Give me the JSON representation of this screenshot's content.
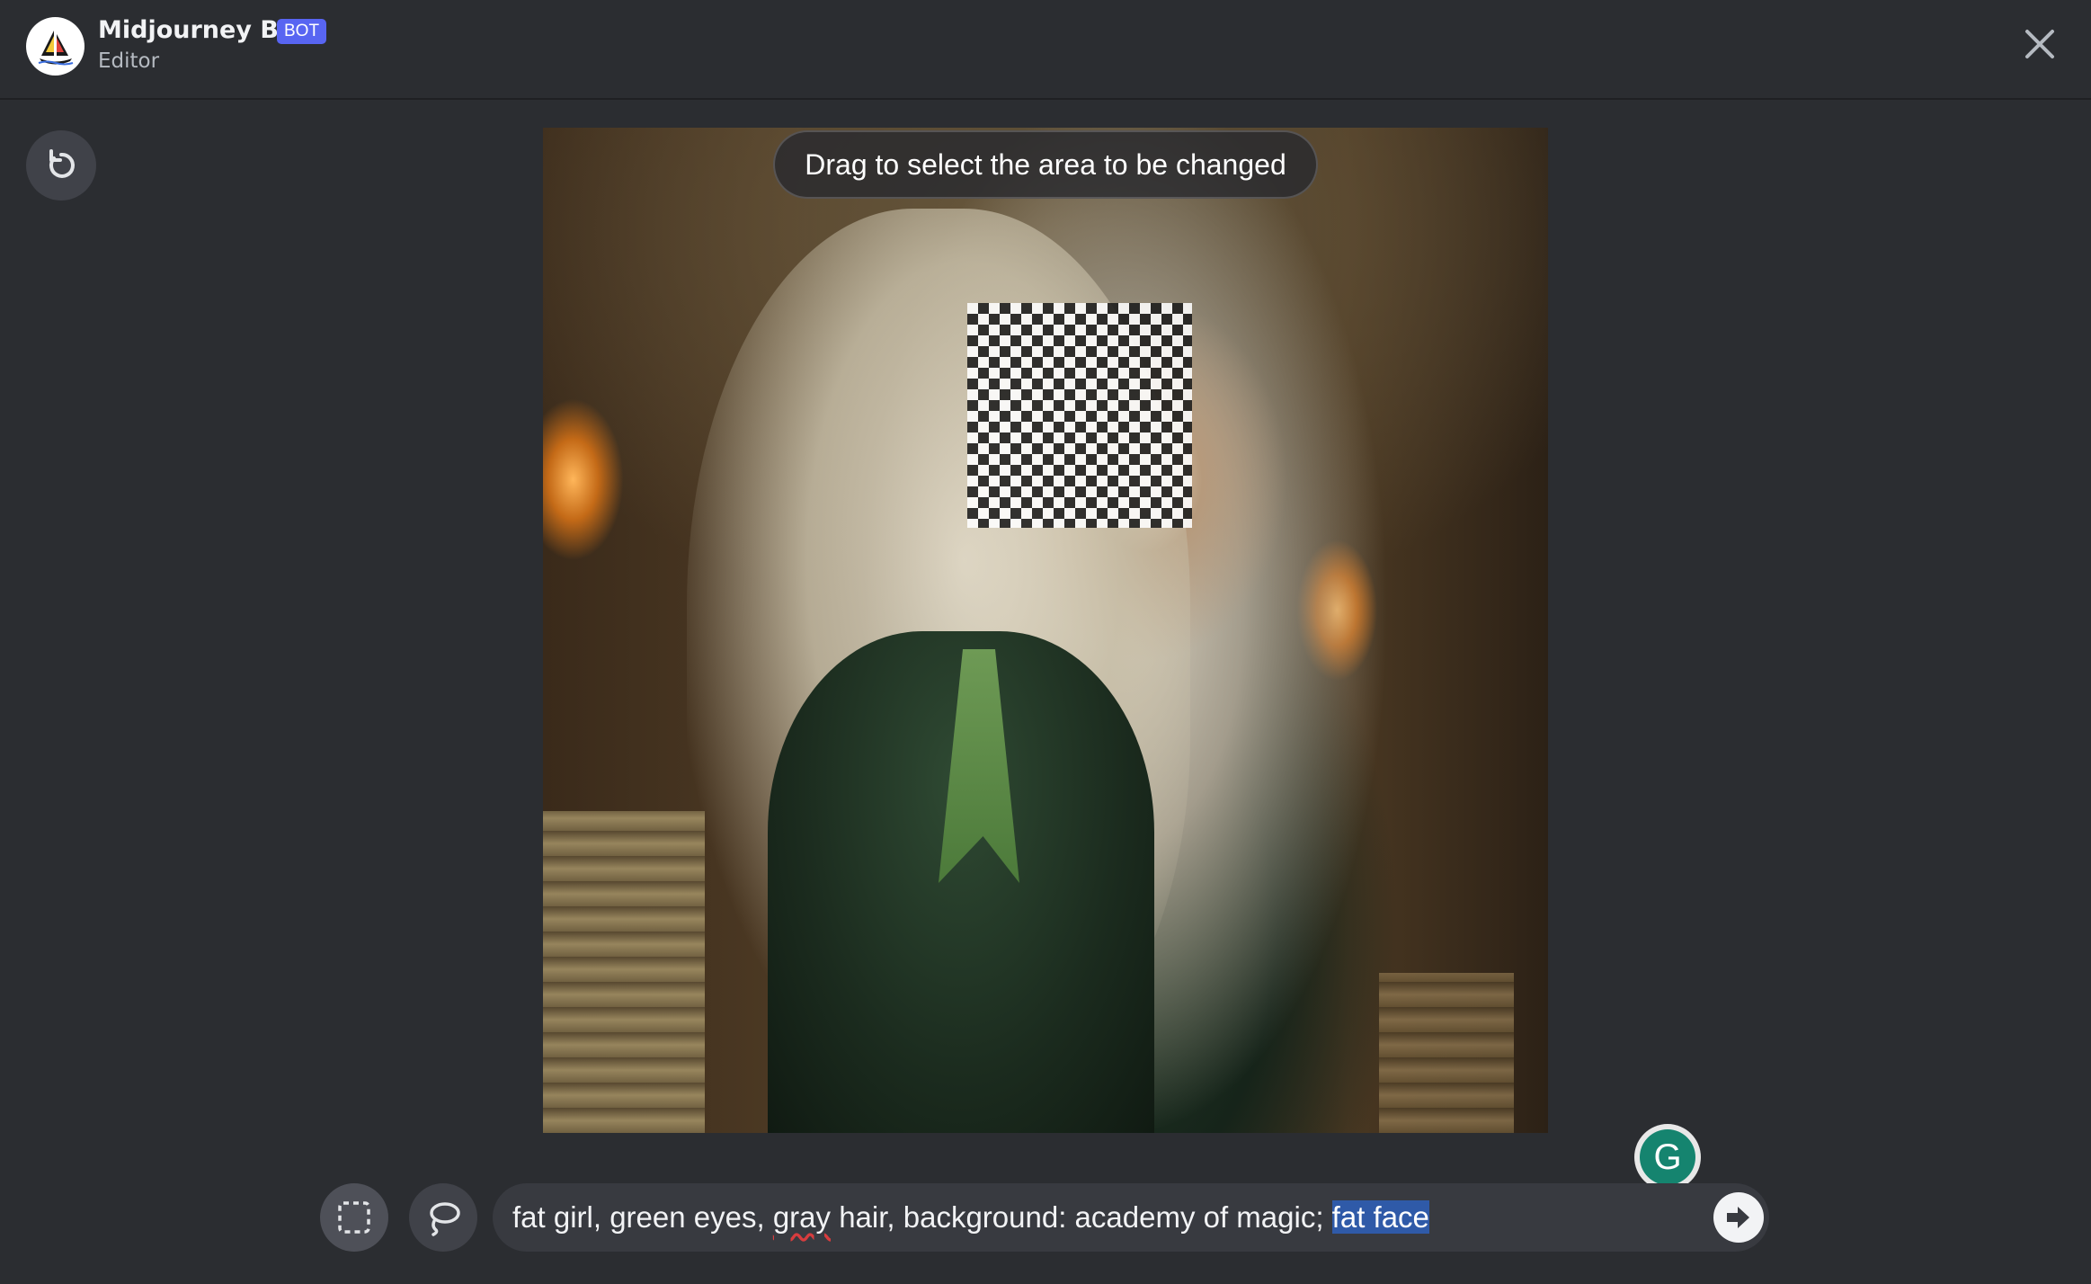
{
  "header": {
    "bot_name": "Midjourney Bot",
    "badge": "BOT",
    "subtitle": "Editor"
  },
  "canvas": {
    "hint": "Drag to select the area to be changed"
  },
  "prompt": {
    "text_before": "fat girl, green eyes, ",
    "misspelled_word": "gray",
    "text_middle": " hair, background: academy of magic; ",
    "selected_text": "fat face"
  },
  "grammarly": {
    "letter": "G"
  },
  "icons": {
    "avatar": "midjourney-boat-icon",
    "close": "close-icon",
    "reset": "reset-icon",
    "rect_select": "rectangle-select-icon",
    "lasso_select": "lasso-icon",
    "send": "send-arrow-icon",
    "grammarly": "grammarly-icon"
  },
  "colors": {
    "background": "#2b2d31",
    "badge": "#5865f2",
    "prompt_bar": "#383a40",
    "selection": "#2f5aa8",
    "grammarly": "#15846f"
  }
}
